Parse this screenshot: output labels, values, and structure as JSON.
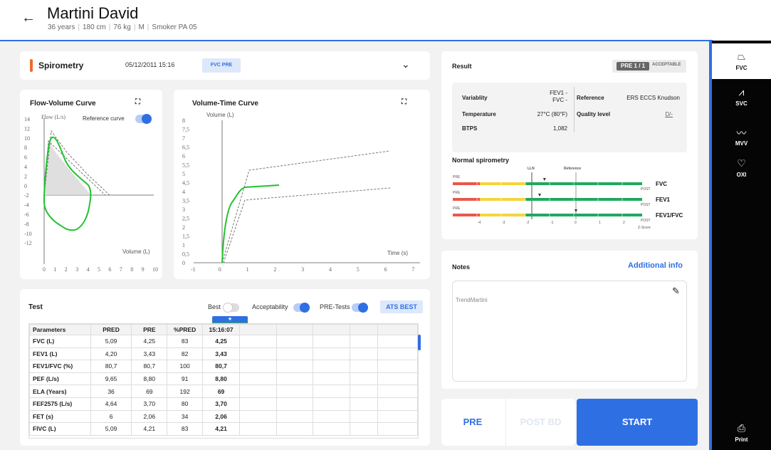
{
  "patient": {
    "name": "Martini David",
    "age": "36 years",
    "height": "180 cm",
    "weight": "76 kg",
    "sex": "M",
    "smoker": "Smoker PA 05"
  },
  "spirometry": {
    "title": "Spirometry",
    "datetime": "05/12/2011 15:16",
    "badge": "FVC PRE"
  },
  "flow_volume": {
    "title": "Flow-Volume Curve",
    "reference_label": "Reference curve",
    "y_label": "Flow (L/s)",
    "x_label": "Volume (L)",
    "y_ticks": [
      "14",
      "12",
      "10",
      "8",
      "6",
      "4",
      "2",
      "0",
      "-2",
      "-4",
      "-6",
      "-8",
      "-10",
      "-12"
    ],
    "x_ticks": [
      "0",
      "1",
      "2",
      "3",
      "4",
      "5",
      "6",
      "7",
      "8",
      "9",
      "10"
    ]
  },
  "volume_time": {
    "title": "Volume-Time Curve",
    "y_label": "Volume (L)",
    "x_label": "Time (s)",
    "y_ticks": [
      "8",
      "7,5",
      "7",
      "6,5",
      "6",
      "5,5",
      "5",
      "4,5",
      "4",
      "3,5",
      "3",
      "2,5",
      "2",
      "1,5",
      "1",
      "0,5",
      "0"
    ],
    "x_ticks": [
      "-1",
      "0",
      "1",
      "2",
      "3",
      "4",
      "5",
      "6",
      "7"
    ]
  },
  "test": {
    "title": "Test",
    "best_label": "Best",
    "acceptability_label": "Acceptability",
    "pretests_label": "PRE-Tests",
    "ats_label": "ATS BEST",
    "best_marker": "★",
    "columns": [
      "Parameters",
      "PRED",
      "PRE",
      "%PRED",
      "15:16:07"
    ],
    "rows": [
      [
        "FVC (L)",
        "5,09",
        "4,25",
        "83",
        "4,25"
      ],
      [
        "FEV1 (L)",
        "4,20",
        "3,43",
        "82",
        "3,43"
      ],
      [
        "FEV1/FVC (%)",
        "80,7",
        "80,7",
        "100",
        "80,7"
      ],
      [
        "PEF (L/s)",
        "9,65",
        "8,80",
        "91",
        "8,80"
      ],
      [
        "ELA (Years)",
        "36",
        "69",
        "192",
        "69"
      ],
      [
        "FEF2575 (L/s)",
        "4,64",
        "3,70",
        "80",
        "3,70"
      ],
      [
        "FET (s)",
        "6",
        "2,06",
        "34",
        "2,06"
      ],
      [
        "FIVC (L)",
        "5,09",
        "4,21",
        "83",
        "4,21"
      ]
    ]
  },
  "result": {
    "title": "Result",
    "pre_badge": "PRE 1 / 1",
    "acceptable": "ACCEPTABLE",
    "variability_label": "Variablity",
    "variability_value_1": "FEV1 -",
    "variability_value_2": "FVC -",
    "reference_label": "Reference",
    "reference_value": "ERS ECCS Knudson",
    "temperature_label": "Temperature",
    "temperature_value": "27°C (80°F)",
    "quality_label": "Quality level",
    "quality_value": "D/-",
    "btps_label": "BTPS",
    "btps_value": "1,082",
    "normal_title": "Normal spirometry",
    "lln_label": "LLN",
    "ref_label": "Reference",
    "pre_tag": "PRE",
    "post_tag": "POST",
    "zscore_label": "Z-Score",
    "bar_labels": [
      "FVC",
      "FEV1",
      "FEV1/FVC"
    ],
    "zscore_ticks": [
      "-4",
      "-3",
      "-2",
      "-1",
      "0",
      "1",
      "2"
    ],
    "zscores": [
      -1.3,
      -1.5,
      0.0
    ]
  },
  "notes": {
    "title": "Notes",
    "additional_info": "Additional info",
    "text": "TrendMartini"
  },
  "actions": {
    "pre": "PRE",
    "post": "POST BD",
    "start": "START"
  },
  "sidebar": {
    "items": [
      "FVC",
      "SVC",
      "MVV",
      "OXI"
    ],
    "print": "Print"
  },
  "colors": {
    "accent": "#2f6fe4",
    "curve": "#22c22e",
    "red": "#e8584a",
    "yellow": "#f6d43c",
    "green": "#1fa95e"
  }
}
